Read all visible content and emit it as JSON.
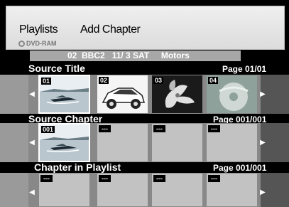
{
  "header": {
    "title": "Playlists",
    "subtitle": "DVD-RAM",
    "action": "Add Chapter"
  },
  "info_bar": "02  BBC2   11/ 3 SAT     Motors",
  "sections": {
    "source_title": {
      "label": "Source Title",
      "page": "Page 01/01",
      "tiles": [
        {
          "num": "01",
          "thumb": "boat-thumbnail",
          "selected": true
        },
        {
          "num": "02",
          "thumb": "car-thumbnail",
          "selected": false
        },
        {
          "num": "03",
          "thumb": "flower-thumbnail",
          "selected": false
        },
        {
          "num": "04",
          "thumb": "disc-thumbnail",
          "selected": false
        }
      ]
    },
    "source_chapter": {
      "label": "Source Chapter",
      "page": "Page 001/001",
      "tiles": [
        {
          "num": "001",
          "thumb": "boat-thumbnail",
          "selected": true
        },
        {
          "num": "---",
          "thumb": "",
          "selected": false
        },
        {
          "num": "---",
          "thumb": "",
          "selected": false
        },
        {
          "num": "---",
          "thumb": "",
          "selected": false
        }
      ]
    },
    "chapter_in_playlist": {
      "label": "Chapter in Playlist",
      "page": "Page 001/001",
      "tiles": [
        {
          "num": "---",
          "thumb": "",
          "selected": false
        },
        {
          "num": "---",
          "thumb": "",
          "selected": false
        },
        {
          "num": "---",
          "thumb": "",
          "selected": false
        },
        {
          "num": "---",
          "thumb": "",
          "selected": false
        }
      ]
    }
  },
  "icons": {
    "left": "left-arrow-icon",
    "right": "right-arrow-icon",
    "disc": "disc-icon"
  }
}
